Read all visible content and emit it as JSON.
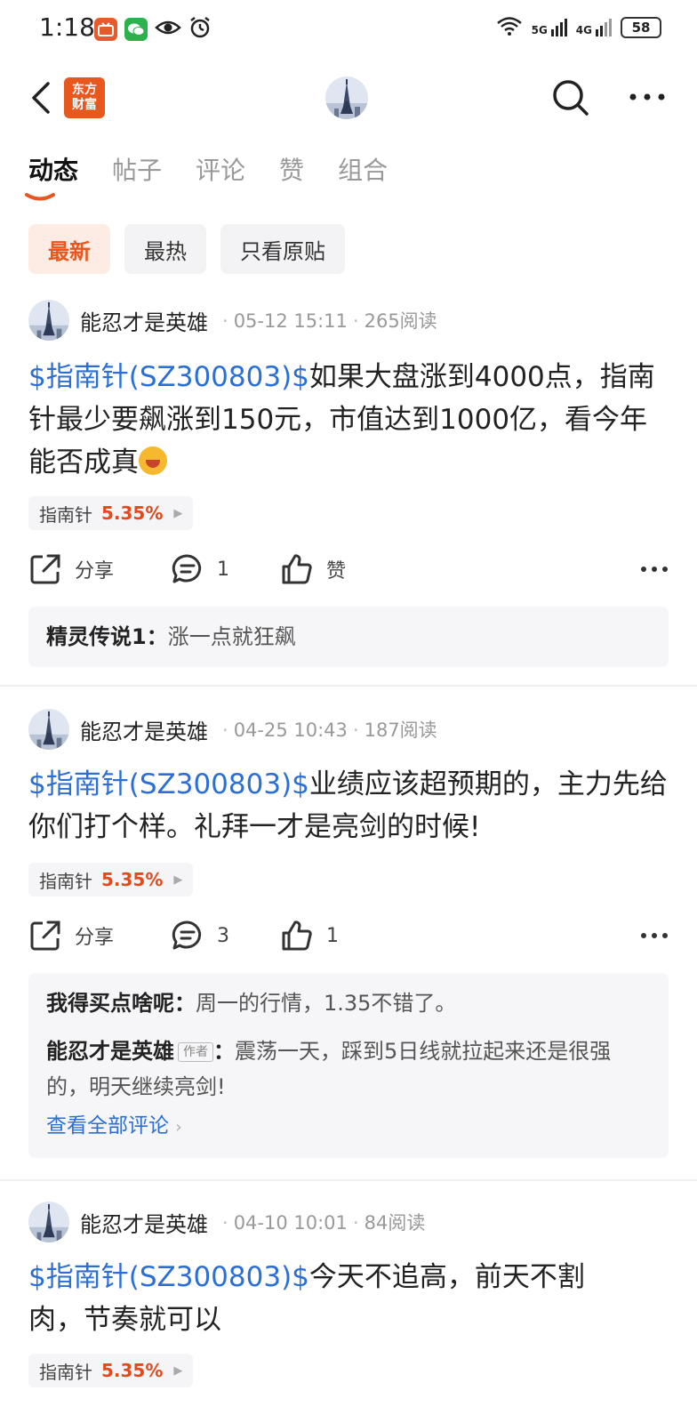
{
  "status_bar": {
    "time": "1:18",
    "network_5g": "5G",
    "network_4g": "4G",
    "battery": "58",
    "icons": [
      "bilibili-tv-icon",
      "wechat-icon",
      "eye-icon",
      "alarm-icon",
      "wifi-icon",
      "signal-icon",
      "battery-icon"
    ]
  },
  "header": {
    "logo_line1": "东方",
    "logo_line2": "财富"
  },
  "tabs": [
    {
      "label": "动态",
      "active": true
    },
    {
      "label": "帖子",
      "active": false
    },
    {
      "label": "评论",
      "active": false
    },
    {
      "label": "赞",
      "active": false
    },
    {
      "label": "组合",
      "active": false
    }
  ],
  "filters": [
    {
      "label": "最新",
      "active": true
    },
    {
      "label": "最热",
      "active": false
    },
    {
      "label": "只看原贴",
      "active": false
    }
  ],
  "colors": {
    "accent": "#e8571e",
    "link": "#2b6fd6",
    "up": "#e24a1c"
  },
  "posts": [
    {
      "author": "能忍才是英雄",
      "time": "05-12 15:11",
      "reads": "265阅读",
      "stock_link": "$指南针(SZ300803)$",
      "text": "如果大盘涨到4000点，指南针最少要飙涨到150元，市值达到1000亿，看今年能否成真",
      "emoji": "grinning-face-emoji",
      "tag_name": "指南针",
      "tag_pct": "5.35%",
      "share": "分享",
      "comment_count": "1",
      "like": "赞",
      "comments": [
        {
          "user": "精灵传说1",
          "sep": "：",
          "text": "涨一点就狂飙"
        }
      ]
    },
    {
      "author": "能忍才是英雄",
      "time": "04-25 10:43",
      "reads": "187阅读",
      "stock_link": "$指南针(SZ300803)$",
      "text": "业绩应该超预期的，主力先给你们打个样。礼拜一才是亮剑的时候!",
      "tag_name": "指南针",
      "tag_pct": "5.35%",
      "share": "分享",
      "comment_count": "3",
      "like": "1",
      "comments": [
        {
          "user": "我得买点啥呢",
          "sep": "：",
          "text": "周一的行情，1.35不错了。"
        },
        {
          "user": "能忍才是英雄",
          "badge": "作者",
          "sep": "：",
          "text": "震荡一天，踩到5日线就拉起来还是很强的，明天继续亮剑!"
        }
      ],
      "view_all": "查看全部评论"
    },
    {
      "author": "能忍才是英雄",
      "time": "04-10 10:01",
      "reads": "84阅读",
      "stock_link": "$指南针(SZ300803)$",
      "text": "今天不追高，前天不割肉，节奏就可以",
      "tag_name": "指南针",
      "tag_pct": "5.35%"
    }
  ]
}
